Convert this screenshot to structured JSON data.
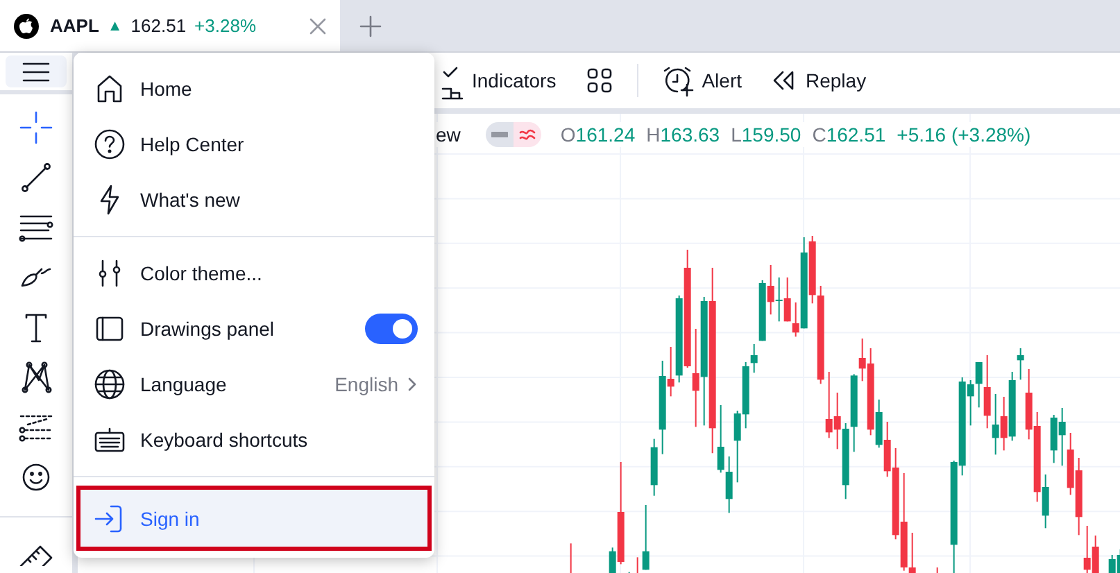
{
  "tab": {
    "symbol": "AAPL",
    "arrow": "▲",
    "price": "162.51",
    "change": "+3.28%"
  },
  "toolbar": {
    "items": [
      {
        "kind": "indicators",
        "label": "Indicators"
      },
      {
        "kind": "layouts"
      },
      {
        "kind": "alert",
        "label": "Alert"
      },
      {
        "kind": "replay",
        "label": "Replay"
      }
    ]
  },
  "legend": {
    "title_fragment": "ew",
    "values": [
      {
        "prefix": "O",
        "value": "161.24"
      },
      {
        "prefix": "H",
        "value": "163.63"
      },
      {
        "prefix": "L",
        "value": "159.50"
      },
      {
        "prefix": "C",
        "value": "162.51"
      }
    ],
    "change": "+5.16 (+3.28%)"
  },
  "drawing_tools": [
    {
      "selected": true
    },
    {
      "selected": false
    },
    {
      "selected": false
    },
    {
      "selected": false
    },
    {
      "selected": false
    },
    {
      "selected": false
    },
    {
      "selected": false
    },
    {
      "selected": false
    },
    {
      "selected": false
    }
  ],
  "menu": {
    "items": [
      {
        "kind": "link",
        "label": "Home",
        "highlighted": false
      },
      {
        "kind": "link",
        "label": "Help Center",
        "highlighted": false
      },
      {
        "kind": "link",
        "label": "What's new",
        "highlighted": false
      },
      {
        "kind": "divider"
      },
      {
        "kind": "link",
        "label": "Color theme...",
        "highlighted": false
      },
      {
        "kind": "toggle",
        "label": "Drawings panel",
        "on": true,
        "highlighted": false
      },
      {
        "kind": "submenu",
        "label": "Language",
        "value": "English",
        "highlighted": false
      },
      {
        "kind": "link",
        "label": "Keyboard shortcuts",
        "highlighted": false
      },
      {
        "kind": "divider"
      },
      {
        "kind": "link",
        "label": "Sign in",
        "highlighted": true
      }
    ]
  }
}
